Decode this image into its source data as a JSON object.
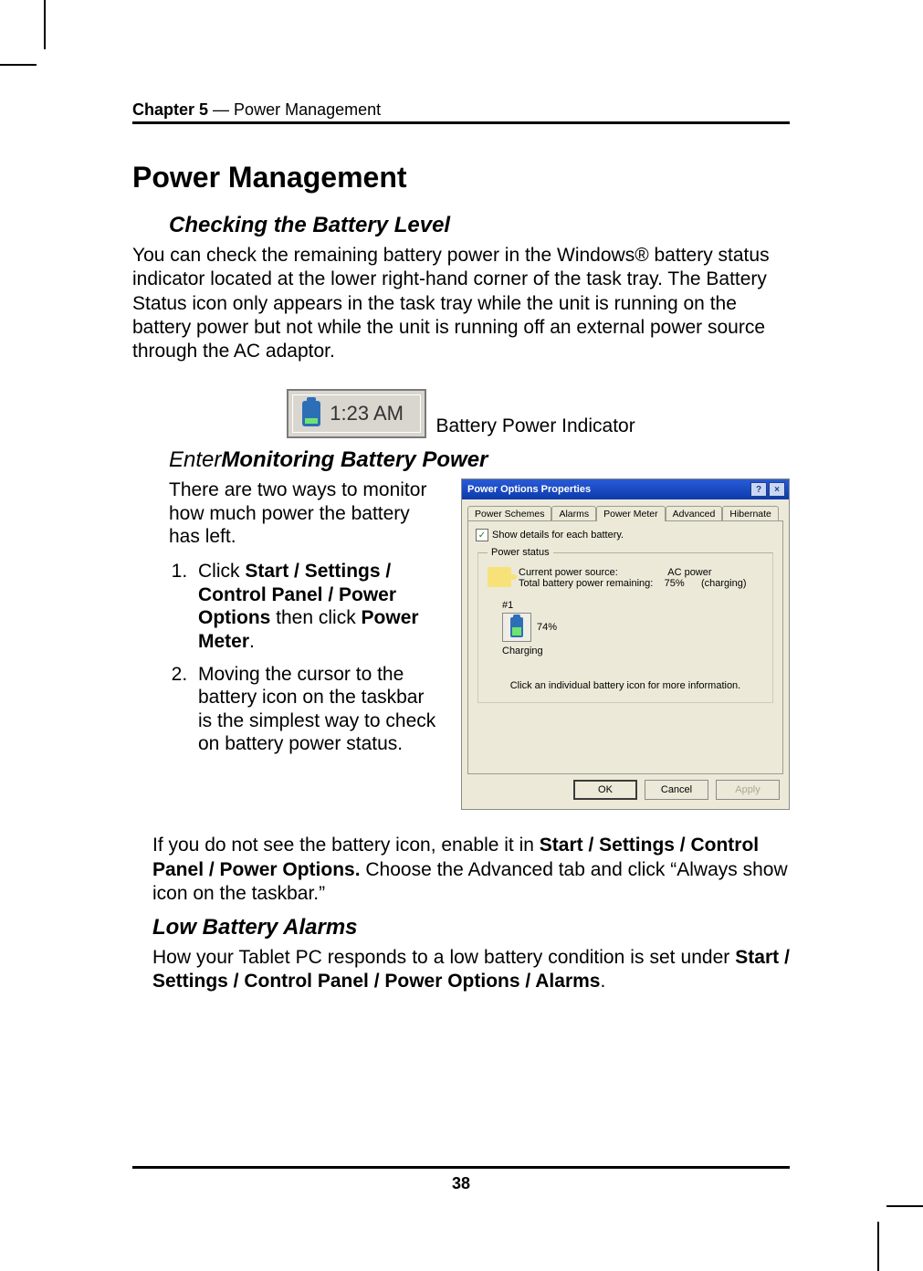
{
  "header": {
    "chapter": "Chapter 5",
    "separator": " — ",
    "title": "Power Management"
  },
  "h1": "Power Management",
  "sec1": {
    "heading": "Checking the Battery Level",
    "body": "You can check the remaining battery power in the Windows® battery status indicator located at the lower right-hand corner of the task tray. The Battery Status icon only appears in the task tray while the unit is running on the battery power but not while the unit is running off an external power source through the AC adaptor."
  },
  "tray": {
    "time": "1:23 AM",
    "caption": "Battery Power Indicator"
  },
  "sec2": {
    "prefix": "Enter",
    "heading": "Monitoring Battery Power",
    "intro": "There are two ways to monitor how much power the battery has left.",
    "steps": {
      "s1_a": "Click ",
      "s1_b": "Start / Settings / Control Panel / Power Options",
      "s1_c": " then click ",
      "s1_d": "Power Meter",
      "s1_e": ".",
      "s2": "Moving the cursor to the battery icon on the taskbar is the simplest way to check on battery power status."
    }
  },
  "dialog": {
    "title": "Power Options Properties",
    "help_btn": "?",
    "close_btn": "×",
    "tabs": {
      "schemes": "Power Schemes",
      "alarms": "Alarms",
      "meter": "Power Meter",
      "advanced": "Advanced",
      "hibernate": "Hibernate"
    },
    "show_details": "Show details for each battery.",
    "group": "Power status",
    "cps_label": "Current power source:",
    "cps_value": "AC power",
    "tbr_label": "Total battery power remaining:",
    "tbr_value": "75%",
    "tbr_suffix": "(charging)",
    "num_label": "#1",
    "pct": "74%",
    "charging": "Charging",
    "hint": "Click an individual battery icon for more information.",
    "ok": "OK",
    "cancel": "Cancel",
    "apply": "Apply"
  },
  "after": {
    "p_a": "If you do not see the battery icon, enable it in ",
    "p_b": "Start / Settings / Control Panel / Power Options.",
    "p_c": " Choose the Advanced tab and click “Always show icon on the taskbar.”"
  },
  "sec3": {
    "heading": "Low Battery Alarms",
    "p_a": "How your Tablet PC responds to a low battery condition is set under ",
    "p_b": "Start / Settings / Control Panel / Power Options / Alarms",
    "p_c": "."
  },
  "page_number": "38"
}
